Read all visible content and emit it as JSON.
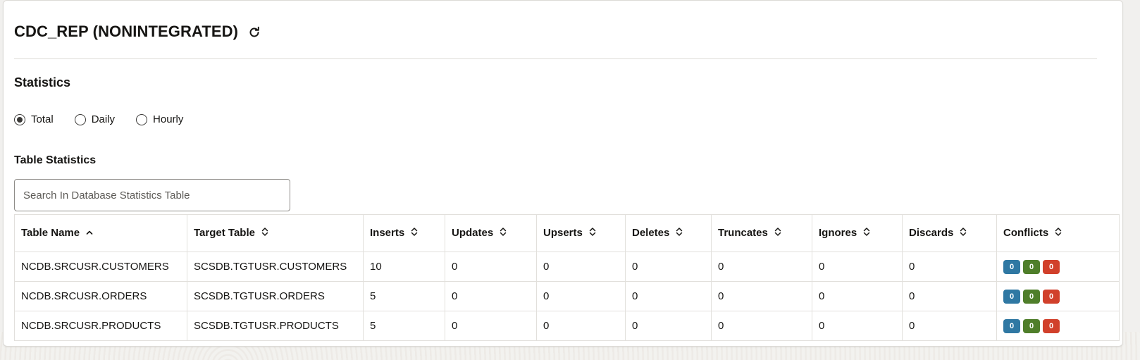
{
  "header": {
    "title": "CDC_REP (NONINTEGRATED)",
    "refresh_icon": "refresh-icon"
  },
  "statistics": {
    "title": "Statistics",
    "options": [
      {
        "label": "Total",
        "selected": true
      },
      {
        "label": "Daily",
        "selected": false
      },
      {
        "label": "Hourly",
        "selected": false
      }
    ]
  },
  "table_stats": {
    "title": "Table Statistics",
    "search_placeholder": "Search In Database Statistics Table",
    "columns": [
      "Table Name",
      "Target Table",
      "Inserts",
      "Updates",
      "Upserts",
      "Deletes",
      "Truncates",
      "Ignores",
      "Discards",
      "Conflicts"
    ],
    "sorted_column": "Table Name",
    "sort_direction": "asc",
    "rows": [
      {
        "table_name": "NCDB.SRCUSR.CUSTOMERS",
        "target_table": "SCSDB.TGTUSR.CUSTOMERS",
        "inserts": "10",
        "updates": "0",
        "upserts": "0",
        "deletes": "0",
        "truncates": "0",
        "ignores": "0",
        "discards": "0",
        "conflicts": [
          "0",
          "0",
          "0"
        ]
      },
      {
        "table_name": "NCDB.SRCUSR.ORDERS",
        "target_table": "SCSDB.TGTUSR.ORDERS",
        "inserts": "5",
        "updates": "0",
        "upserts": "0",
        "deletes": "0",
        "truncates": "0",
        "ignores": "0",
        "discards": "0",
        "conflicts": [
          "0",
          "0",
          "0"
        ]
      },
      {
        "table_name": "NCDB.SRCUSR.PRODUCTS",
        "target_table": "SCSDB.TGTUSR.PRODUCTS",
        "inserts": "5",
        "updates": "0",
        "upserts": "0",
        "deletes": "0",
        "truncates": "0",
        "ignores": "0",
        "discards": "0",
        "conflicts": [
          "0",
          "0",
          "0"
        ]
      }
    ],
    "conflict_colors": [
      "#2f78a3",
      "#4f7e2a",
      "#d1402b"
    ]
  }
}
